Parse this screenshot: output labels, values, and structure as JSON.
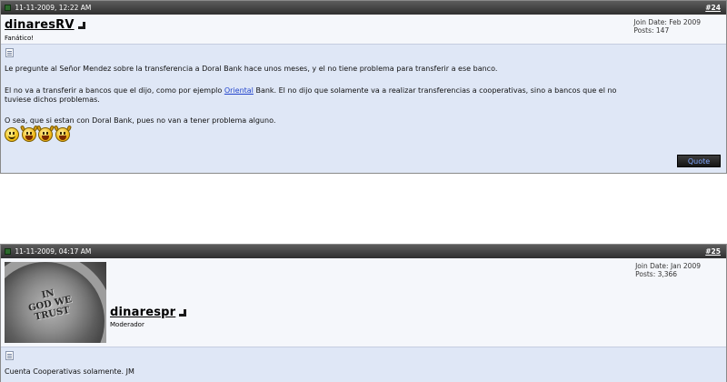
{
  "posts": [
    {
      "date": "11-11-2009, 12:22 AM",
      "number": "#24",
      "username": "dinaresRV",
      "user_title": "Fanático!",
      "join_date": "Join Date: Feb 2009",
      "posts_count": "Posts: 147",
      "paragraphs": [
        "Le pregunte al Señor Mendez sobre la transferencia a Doral Bank hace unos meses, y el no tiene problema para transferir a ese banco.",
        "El no va a transferir a bancos que el dijo, como por ejemplo ",
        "Oriental",
        " Bank. El no dijo que solamente va a realizar transferencias a cooperativas, sino a bancos que el no",
        "tuviese dichos problemas.",
        "O sea, que si estan con Doral Bank, pues no van a tener problema alguno."
      ],
      "smilies": [
        "smile-icon",
        "banana-icon",
        "banana-icon",
        "banana-icon"
      ],
      "quote_label": "Quote"
    },
    {
      "date": "11-11-2009, 04:17 AM",
      "number": "#25",
      "username": "dinarespr",
      "user_title": "Moderador",
      "join_date": "Join Date: Jan 2009",
      "posts_count": "Posts: 3,366",
      "avatar_text": [
        "IN",
        "GOD WE",
        "TRUST"
      ],
      "paragraphs": [
        "Cuenta Cooperativas solamente. JM"
      ]
    }
  ]
}
